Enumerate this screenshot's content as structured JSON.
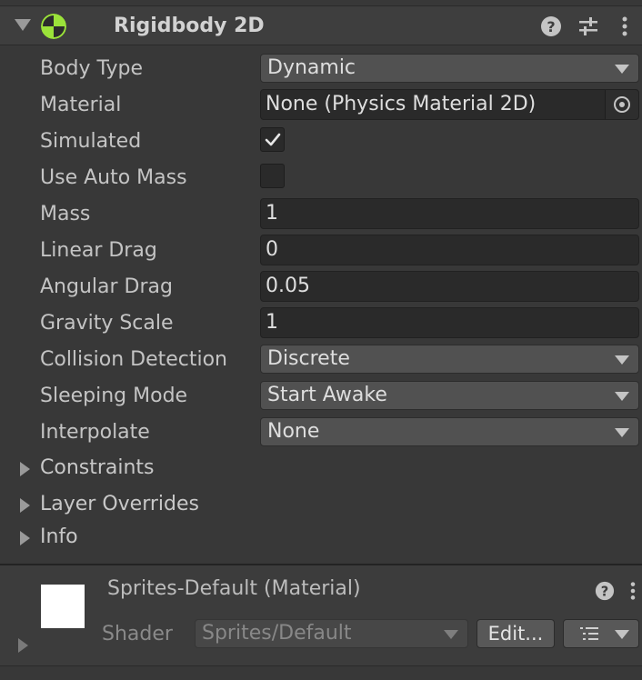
{
  "component": {
    "title": "Rigidbody 2D",
    "enabled": true,
    "icons": [
      "help-icon",
      "preset-icon",
      "more-icon"
    ]
  },
  "properties": [
    {
      "label": "Body Type",
      "type": "dropdown",
      "value": "Dynamic"
    },
    {
      "label": "Material",
      "type": "object",
      "value": "None (Physics Material 2D)"
    },
    {
      "label": "Simulated",
      "type": "checkbox",
      "checked": true
    },
    {
      "label": "Use Auto Mass",
      "type": "checkbox",
      "checked": false
    },
    {
      "label": "Mass",
      "type": "number",
      "value": "1"
    },
    {
      "label": "Linear Drag",
      "type": "number",
      "value": "0"
    },
    {
      "label": "Angular Drag",
      "type": "number",
      "value": "0.05"
    },
    {
      "label": "Gravity Scale",
      "type": "number",
      "value": "1"
    },
    {
      "label": "Collision Detection",
      "type": "dropdown",
      "value": "Discrete"
    },
    {
      "label": "Sleeping Mode",
      "type": "dropdown",
      "value": "Start Awake"
    },
    {
      "label": "Interpolate",
      "type": "dropdown",
      "value": "None"
    }
  ],
  "foldouts": [
    "Constraints",
    "Layer Overrides",
    "Info"
  ],
  "material": {
    "title": "Sprites-Default (Material)",
    "shader_label": "Shader",
    "shader_value": "Sprites/Default",
    "edit_label": "Edit..."
  },
  "colors": {
    "background": "#383838",
    "field": "#2a2a2a",
    "dropdown": "#515151",
    "enable_icon": "#9be33a"
  }
}
